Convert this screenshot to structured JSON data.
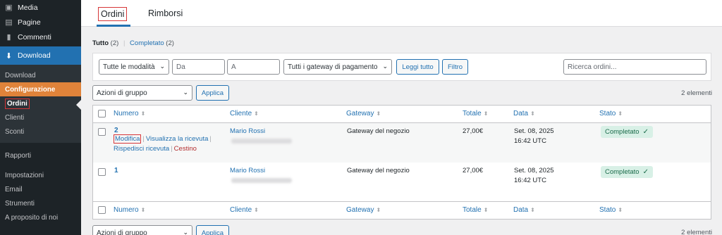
{
  "sidebar": {
    "top_items": [
      {
        "label": "Media",
        "icon": "media-icon"
      },
      {
        "label": "Pagine",
        "icon": "pages-icon"
      },
      {
        "label": "Commenti",
        "icon": "comments-icon"
      }
    ],
    "current": {
      "label": "Download",
      "icon": "download-icon"
    },
    "submenu": [
      {
        "label": "Download"
      },
      {
        "label": "Configurazione"
      },
      {
        "label": "Ordini"
      },
      {
        "label": "Clienti"
      },
      {
        "label": "Sconti"
      }
    ],
    "lower_items": [
      {
        "label": "Rapporti"
      },
      {
        "label": "Impostazioni"
      },
      {
        "label": "Email"
      },
      {
        "label": "Strumenti"
      },
      {
        "label": "A proposito di noi"
      }
    ]
  },
  "tabs": [
    {
      "label": "Ordini"
    },
    {
      "label": "Rimborsi"
    }
  ],
  "views": {
    "all_label": "Tutto",
    "all_count": "(2)",
    "completed_label": "Completato",
    "completed_count": "(2)"
  },
  "filters": {
    "mode_select": "Tutte le modalità",
    "from_placeholder": "Da",
    "to_placeholder": "A",
    "gateway_select": "Tutti i gateway di pagamento",
    "read_all_button": "Leggi tutto",
    "filter_button": "Filtro",
    "search_placeholder": "Ricerca ordini..."
  },
  "bulk": {
    "select": "Azioni di gruppo",
    "apply": "Applica",
    "count": "2 elementi"
  },
  "table": {
    "columns": [
      "Numero",
      "Cliente",
      "Gateway",
      "Totale",
      "Data",
      "Stato"
    ],
    "rows": [
      {
        "number": "2",
        "customer": "Mario Rossi",
        "gateway": "Gateway del negozio",
        "total": "27,00€",
        "date": "Set. 08, 2025",
        "time": "16:42 UTC",
        "status": "Completato",
        "actions": {
          "edit": "Modifica",
          "view_receipt": "Visualizza la ricevuta",
          "resend_receipt": "Rispedisci ricevuta",
          "trash": "Cestino"
        }
      },
      {
        "number": "1",
        "customer": "Mario Rossi",
        "gateway": "Gateway del negozio",
        "total": "27,00€",
        "date": "Set. 08, 2025",
        "time": "16:42 UTC",
        "status": "Completato"
      }
    ]
  },
  "colors": {
    "accent": "#2271b1",
    "sidebar_bg": "#1d2327",
    "highlight_orange": "#e0833a",
    "status_bg": "#d8f0e6",
    "annotation_red": "#d63638"
  }
}
